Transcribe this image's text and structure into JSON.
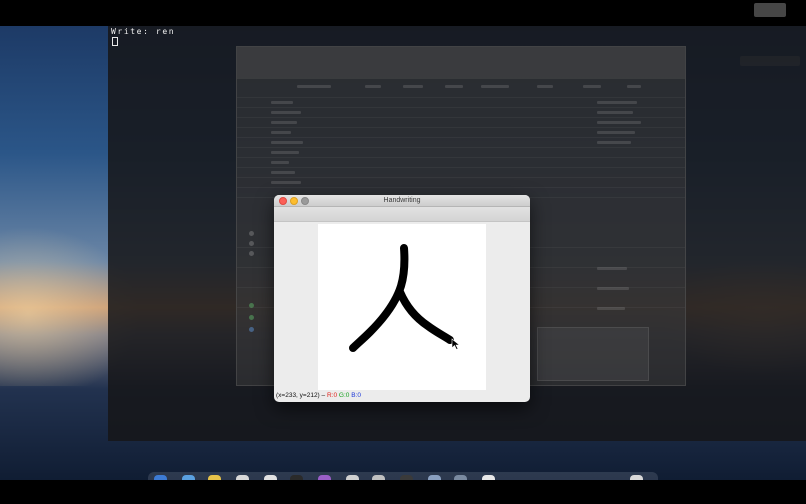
{
  "terminal": {
    "prompt_text": "Write: ren"
  },
  "handwriting_window": {
    "title": "Handwriting",
    "status": {
      "coords": "(x=233, y=212) –",
      "r_label": "R:0",
      "g_label": "G:0",
      "b_label": "B:0"
    }
  },
  "colors": {
    "red_channel": "#e0201a",
    "green_channel": "#14a01e",
    "blue_channel": "#1a36d8",
    "close_button": "#fc5f57",
    "minimize_button": "#fdbd2e",
    "zoom_button_inactive": "#9a9a9a"
  },
  "icons": [
    "close-icon",
    "minimize-icon",
    "zoom-icon",
    "mouse-pointer-icon"
  ]
}
